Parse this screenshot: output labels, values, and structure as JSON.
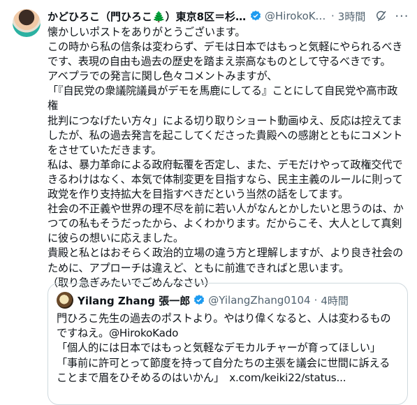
{
  "post": {
    "author_name": "かどひろこ（門ひろこ🌲）東京8区＝杉...",
    "handle": "@HirokoKa...",
    "time": "3時間",
    "more": "···",
    "lines": [
      "懐かしいポストをありがとうございます。",
      "この時から私の信条は変わらず、デモは日本ではもっと気軽にやられるべき",
      "です、表現の自由も過去の歴史を踏まえ崇高なものとして守るべきです。",
      "アベプラでの発言に関し色々コメントみますが、",
      "「『自民党の衆議院議員がデモを馬鹿にしてる』ことにして自民党や高市政権",
      "批判につなげたい方々」による切り取りショート動画ゆえ、反応は控えてま",
      "したが、私の過去発言を起こしてくださった貴殿への感謝とともにコメント",
      "をさせていただきます。",
      "私は、暴力革命による政府転覆を否定し、また、デモだけやって政権交代で",
      "きるわけはなく、本気で体制変更を目指すなら、民主主義のルールに則って",
      "政党を作り支持拡大を目指すべきだという当然の話をしてます。",
      "社会の不正義や世界の理不尽を前に若い人がなんとかしたいと思うのは、か",
      "つての私もそうだったから、よくわかります。だからこそ、大人として真剣",
      "に彼らの想いに応えました。",
      "貴殿と私とはおそらく政治的立場の違う方と理解しますが、より良き社会の",
      "ために、アプローチは違えど、ともに前進できればと思います。",
      "（取り急ぎみたいでごめんなさい）"
    ]
  },
  "quote": {
    "author_name": "Yilang Zhang 張一郎",
    "handle": "@YilangZhang0104",
    "time": "4時間",
    "lines": [
      "門ひろこ先生の過去のポストより。やはり偉くなると、人は変わるもの",
      "ですねえ。@HirokoKado",
      "「個人的には日本ではもっと気軽なデモカルチャーが育ってほしい」",
      "「事前に許可とって節度を持って自分たちの主張を議会に世間に訴える",
      "ことまで眉をひそめるのはいかん」　x.com/keiki22/status..."
    ]
  },
  "colors": {
    "text": "#0f1419",
    "secondary": "#536471",
    "verified": "#1d9bf0",
    "border": "#cfd9de"
  }
}
